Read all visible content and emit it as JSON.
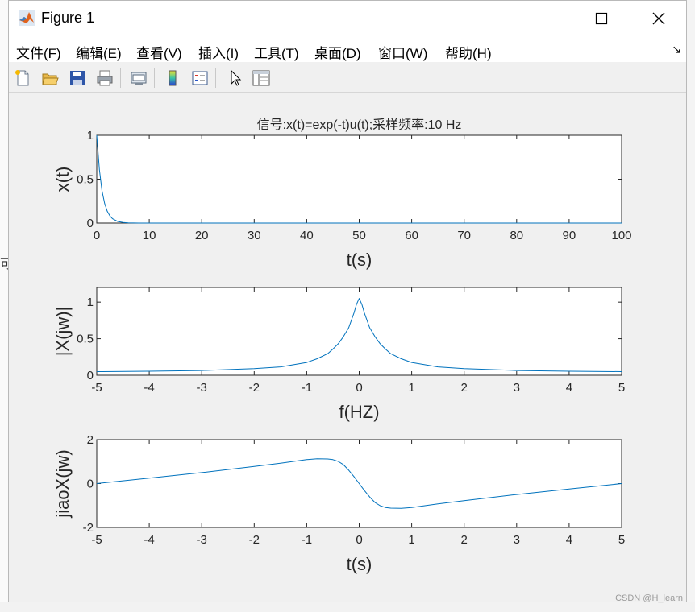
{
  "window": {
    "title": "Figure 1",
    "watermark": "CSDN @H_learn"
  },
  "menu": [
    {
      "label": "文件(F)"
    },
    {
      "label": "编辑(E)"
    },
    {
      "label": "查看(V)"
    },
    {
      "label": "插入(I)"
    },
    {
      "label": "工具(T)"
    },
    {
      "label": "桌面(D)"
    },
    {
      "label": "窗口(W)"
    },
    {
      "label": "帮助(H)"
    }
  ],
  "toolbar": {
    "icons": [
      "new-figure-icon",
      "open-file-icon",
      "save-icon",
      "print-icon",
      "link-plot-icon",
      "insert-colorbar-icon",
      "insert-legend-icon",
      "edit-plot-arrow-icon",
      "property-inspector-icon"
    ]
  },
  "colors": {
    "line": "#0072bd",
    "figure_bg": "#f0f0f0",
    "axes_bg": "#ffffff"
  },
  "chart_data": [
    {
      "type": "line",
      "title": "信号:x(t)=exp(-t)u(t);采样频率:10 Hz",
      "xlabel": "t(s)",
      "ylabel": "x(t)",
      "xlim": [
        0,
        100
      ],
      "ylim": [
        0,
        1
      ],
      "xticks": [
        "0",
        "10",
        "20",
        "30",
        "40",
        "50",
        "60",
        "70",
        "80",
        "90",
        "100"
      ],
      "yticks": [
        "0",
        "0.5",
        "1"
      ],
      "x": [
        0,
        0.5,
        1,
        1.5,
        2,
        2.5,
        3,
        4,
        5,
        6,
        8,
        10,
        20,
        40,
        60,
        80,
        100
      ],
      "y": [
        1,
        0.607,
        0.368,
        0.223,
        0.135,
        0.082,
        0.05,
        0.018,
        0.007,
        0.002,
        0,
        0,
        0,
        0,
        0,
        0,
        0
      ]
    },
    {
      "type": "line",
      "xlabel": "f(HZ)",
      "ylabel": "|X(jw)|",
      "xlim": [
        -5,
        5
      ],
      "ylim": [
        0,
        1.2
      ],
      "xticks": [
        "-5",
        "-4",
        "-3",
        "-2",
        "-1",
        "0",
        "1",
        "2",
        "3",
        "4",
        "5"
      ],
      "yticks": [
        "0",
        "0.5",
        "1"
      ],
      "x": [
        -5,
        -4,
        -3,
        -2,
        -1.5,
        -1,
        -0.8,
        -0.6,
        -0.5,
        -0.4,
        -0.3,
        -0.2,
        -0.1,
        -0.05,
        0,
        0.05,
        0.1,
        0.2,
        0.3,
        0.4,
        0.5,
        0.6,
        0.8,
        1,
        1.5,
        2,
        3,
        4,
        5
      ],
      "y": [
        0.05,
        0.055,
        0.065,
        0.09,
        0.115,
        0.175,
        0.226,
        0.295,
        0.358,
        0.43,
        0.53,
        0.65,
        0.85,
        0.97,
        1.05,
        0.97,
        0.85,
        0.65,
        0.53,
        0.43,
        0.358,
        0.295,
        0.226,
        0.175,
        0.115,
        0.09,
        0.065,
        0.055,
        0.05
      ]
    },
    {
      "type": "line",
      "xlabel": "t(s)",
      "ylabel": "jiaoX(jw)",
      "xlim": [
        -5,
        5
      ],
      "ylim": [
        -2,
        2
      ],
      "xticks": [
        "-5",
        "-4",
        "-3",
        "-2",
        "-1",
        "0",
        "1",
        "2",
        "3",
        "4",
        "5"
      ],
      "yticks": [
        "-2",
        "0",
        "2"
      ],
      "x": [
        -5,
        -4,
        -3,
        -2,
        -1.5,
        -1,
        -0.8,
        -0.6,
        -0.5,
        -0.4,
        -0.3,
        -0.2,
        -0.1,
        0,
        0.1,
        0.2,
        0.3,
        0.4,
        0.5,
        0.6,
        0.8,
        1,
        1.5,
        2,
        3,
        4,
        5
      ],
      "y": [
        0,
        0.25,
        0.5,
        0.78,
        0.93,
        1.09,
        1.13,
        1.12,
        1.09,
        1.01,
        0.86,
        0.61,
        0.32,
        0,
        -0.32,
        -0.61,
        -0.86,
        -1.01,
        -1.09,
        -1.12,
        -1.13,
        -1.09,
        -0.93,
        -0.78,
        -0.5,
        -0.25,
        0
      ]
    }
  ]
}
